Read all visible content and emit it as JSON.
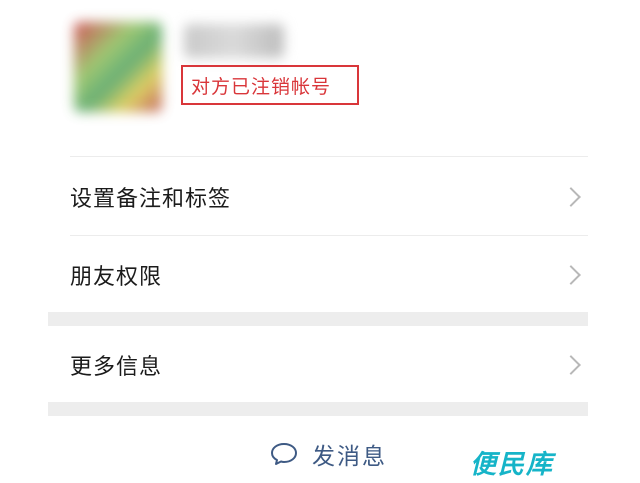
{
  "profile": {
    "status_text": "对方已注销帐号"
  },
  "menu": {
    "items": [
      {
        "label": "设置备注和标签"
      },
      {
        "label": "朋友权限"
      },
      {
        "label": "更多信息"
      }
    ]
  },
  "actions": {
    "send_message_label": "发消息"
  },
  "watermark": {
    "text": "便民库"
  },
  "colors": {
    "status_red": "#d9363a",
    "link_blue": "#3e5a84",
    "watermark_cyan": "#16b4c8"
  },
  "icons": {
    "chevron": "chevron-right-icon",
    "message": "chat-bubble-icon"
  }
}
